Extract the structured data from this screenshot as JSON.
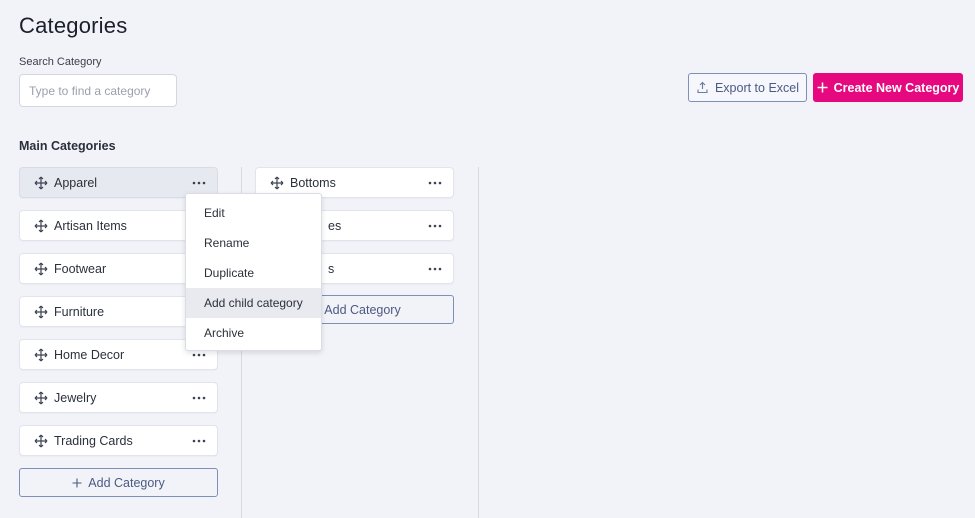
{
  "page": {
    "title": "Categories"
  },
  "search": {
    "label": "Search Category",
    "placeholder": "Type to find a category",
    "value": ""
  },
  "toolbar": {
    "export_label": "Export to Excel",
    "export_icon": "export-icon",
    "create_label": "Create New Category",
    "create_icon": "plus-icon",
    "accent_color": "#e5087e"
  },
  "main_categories": {
    "title": "Main Categories",
    "items": [
      {
        "label": "Apparel",
        "active": true
      },
      {
        "label": "Artisan Items"
      },
      {
        "label": "Footwear"
      },
      {
        "label": "Furniture"
      },
      {
        "label": "Home Decor"
      },
      {
        "label": "Jewelry"
      },
      {
        "label": "Trading Cards"
      }
    ],
    "add_label": "Add Category"
  },
  "sub_categories": {
    "items": [
      {
        "label": "Bottoms"
      },
      {
        "label": "es"
      },
      {
        "label": "s"
      }
    ],
    "add_label": "Add Category"
  },
  "context_menu": {
    "items": [
      {
        "label": "Edit"
      },
      {
        "label": "Rename"
      },
      {
        "label": "Duplicate"
      },
      {
        "label": "Add child category",
        "hover": true
      },
      {
        "label": "Archive"
      }
    ]
  }
}
